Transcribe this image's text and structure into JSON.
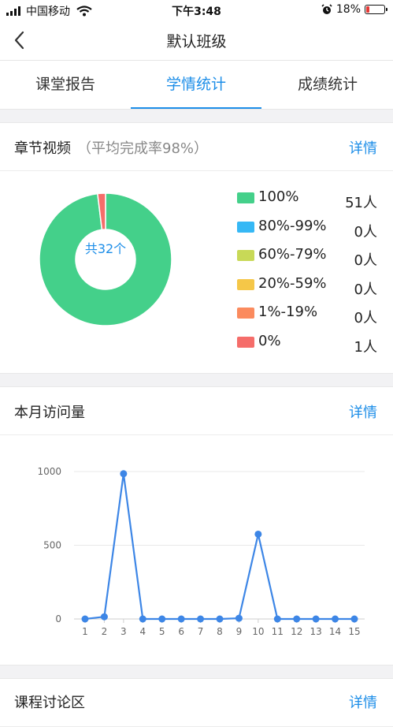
{
  "status_bar": {
    "carrier": "中国移动",
    "time": "下午3:48",
    "battery": "18%",
    "battery_level": 0.18
  },
  "nav": {
    "title": "默认班级"
  },
  "tabs": [
    {
      "label": "课堂报告",
      "active": false
    },
    {
      "label": "学情统计",
      "active": true
    },
    {
      "label": "成绩统计",
      "active": false
    }
  ],
  "video_section": {
    "title": "章节视频",
    "subtitle": "（平均完成率98%）",
    "detail": "详情",
    "center_label": "共32个",
    "legend": [
      {
        "label": "100%",
        "count": "51人",
        "color": "#44d08a"
      },
      {
        "label": "80%-99%",
        "count": "0人",
        "color": "#36b8f5"
      },
      {
        "label": "60%-79%",
        "count": "0人",
        "color": "#c8d957"
      },
      {
        "label": "20%-59%",
        "count": "0人",
        "color": "#f5c748"
      },
      {
        "label": "1%-19%",
        "count": "0人",
        "color": "#fb8b5e"
      },
      {
        "label": "0%",
        "count": "1人",
        "color": "#f56d6a"
      }
    ]
  },
  "visits_section": {
    "title": "本月访问量",
    "detail": "详情"
  },
  "next_section": {
    "title": "课程讨论区",
    "detail": "详情"
  },
  "chart_data": [
    {
      "type": "pie",
      "labels": [
        "100%",
        "80%-99%",
        "60%-79%",
        "20%-59%",
        "1%-19%",
        "0%"
      ],
      "values": [
        51,
        0,
        0,
        0,
        0,
        1
      ],
      "colors": [
        "#44d08a",
        "#36b8f5",
        "#c8d957",
        "#f5c748",
        "#fb8b5e",
        "#f56d6a"
      ]
    },
    {
      "type": "line",
      "x": [
        1,
        2,
        3,
        4,
        5,
        6,
        7,
        8,
        9,
        10,
        11,
        12,
        13,
        14,
        15
      ],
      "values": [
        0,
        15,
        985,
        0,
        0,
        0,
        0,
        0,
        5,
        575,
        0,
        0,
        0,
        0,
        0
      ],
      "ylim": [
        0,
        1000
      ],
      "yticks": [
        0,
        500,
        1000
      ],
      "grid": true,
      "color": "#3d86e6"
    }
  ]
}
